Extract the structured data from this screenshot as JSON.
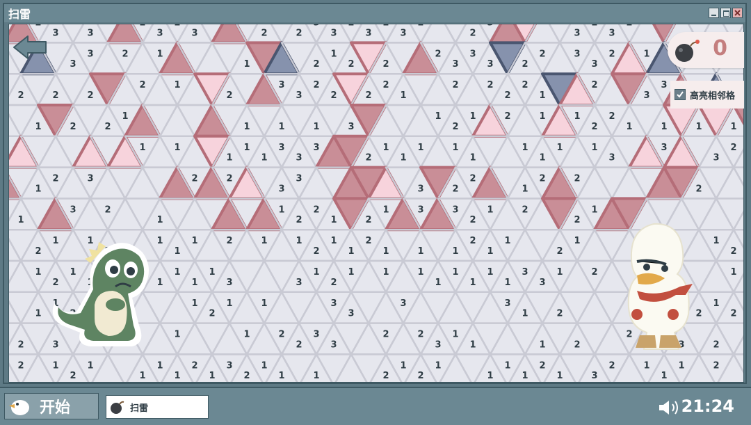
{
  "window": {
    "title": "扫雷",
    "icons": [
      "minimize-icon",
      "maximize-icon",
      "close-icon"
    ]
  },
  "hud": {
    "back_icon": "back-arrow-icon",
    "bomb_icon": "bomb-icon",
    "mine_count": "0",
    "highlight_label": "高亮相邻格",
    "highlight_checked": true
  },
  "board": {
    "grid": "triangular",
    "colors": {
      "background": "#e6e7ee",
      "grid_line": "#c9cad4",
      "flag_light": "#f7d3dc",
      "flag_dark": "#c98e97",
      "flag_border": "#b56d78",
      "mine_fill": "#8692ad",
      "mine_border": "#4a5670",
      "number": "#2f3d45"
    },
    "digit_rows": [
      "2 3 3 2 3 2 3 2",
      "3 3 2 1 1 2 1 2 2 2 3 3 3 2 2",
      "2 2 2 2 1 2 3 3 2 2 2 2 1",
      "1 2 2 1 1 1 1 3 1 2 1 2 1",
      "1 1 1 1 1 1 3 3 3 2 1 1 1",
      "1 2 3 2 2 3 3 3 2 2 1 2 2 2 2 3",
      "1 1 3 2 1 1 2 2 1 2 1 3 3 2 1 2 2",
      "2 1 1 2 1 1 1 2 1 1",
      "1 2 1 1 1 1 1 1 1 1 3 3",
      "2 1 1 2 2 1 2 1 1 3 3 3 3 1",
      "2 3 1 1 1 2 2 3 3 2",
      "2 1 2 1 1 1 1 2 1 3 2 1 1 1",
      "1 1 1 1 1 3 1 2 1 1 1 1"
    ],
    "flagged_light": 18,
    "flagged_dark": 38,
    "mines_revealed": 6
  },
  "characters": {
    "left": "dinosaur-mascot-icon",
    "right": "duck-mascot-icon"
  },
  "taskbar": {
    "start_icon": "duck-logo-icon",
    "start_label": "开始",
    "task_icon": "bomb-icon",
    "task_label": "扫雷",
    "volume_icon": "speaker-icon",
    "clock": "21:24"
  }
}
